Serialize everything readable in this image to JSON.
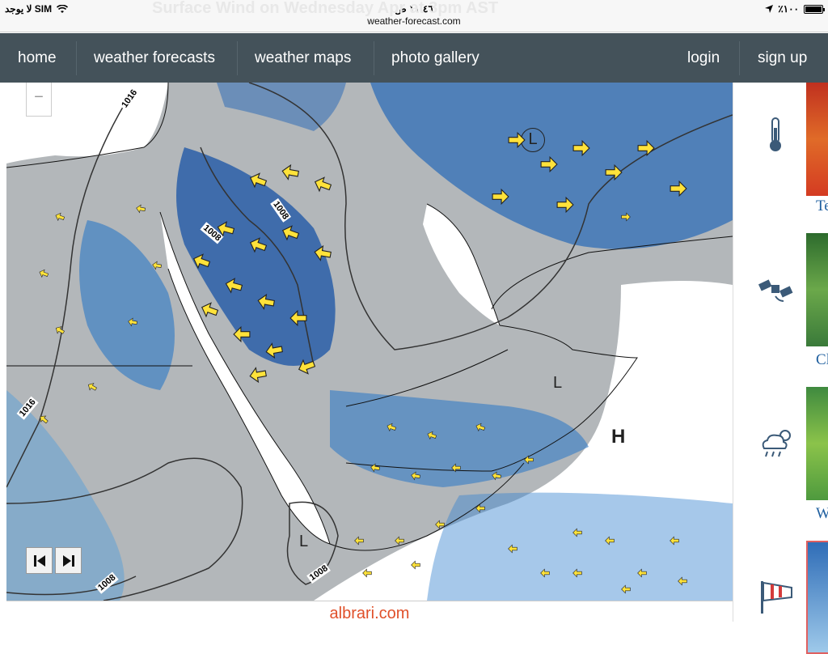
{
  "status_bar": {
    "carrier": "لا يوجد SIM",
    "time": "١١:٤٦ ص",
    "battery": "٪١٠٠",
    "battery_level": 1.0
  },
  "browser": {
    "url": "weather-forecast.com",
    "ghost_title": "Surface Wind on Wednesday Apr at 3pm AST"
  },
  "nav": {
    "home": "home",
    "forecasts": "weather forecasts",
    "maps": "weather maps",
    "gallery": "photo gallery",
    "login": "login",
    "signup": "sign up"
  },
  "map": {
    "zoom_out": "−",
    "isobars": [
      "1016",
      "1008",
      "1008",
      "1016",
      "1008",
      "1008"
    ],
    "pressure_lows": [
      "L",
      "L",
      "L"
    ],
    "pressure_highs": [
      "H"
    ]
  },
  "caption": "albrari.com",
  "sidebar": {
    "items": [
      {
        "icon": "thermometer-icon",
        "label": "Te"
      },
      {
        "icon": "satellite-icon",
        "label": "Cl"
      },
      {
        "icon": "cloud-rain-icon",
        "label": "W"
      },
      {
        "icon": "windsock-icon",
        "label": ""
      }
    ]
  }
}
